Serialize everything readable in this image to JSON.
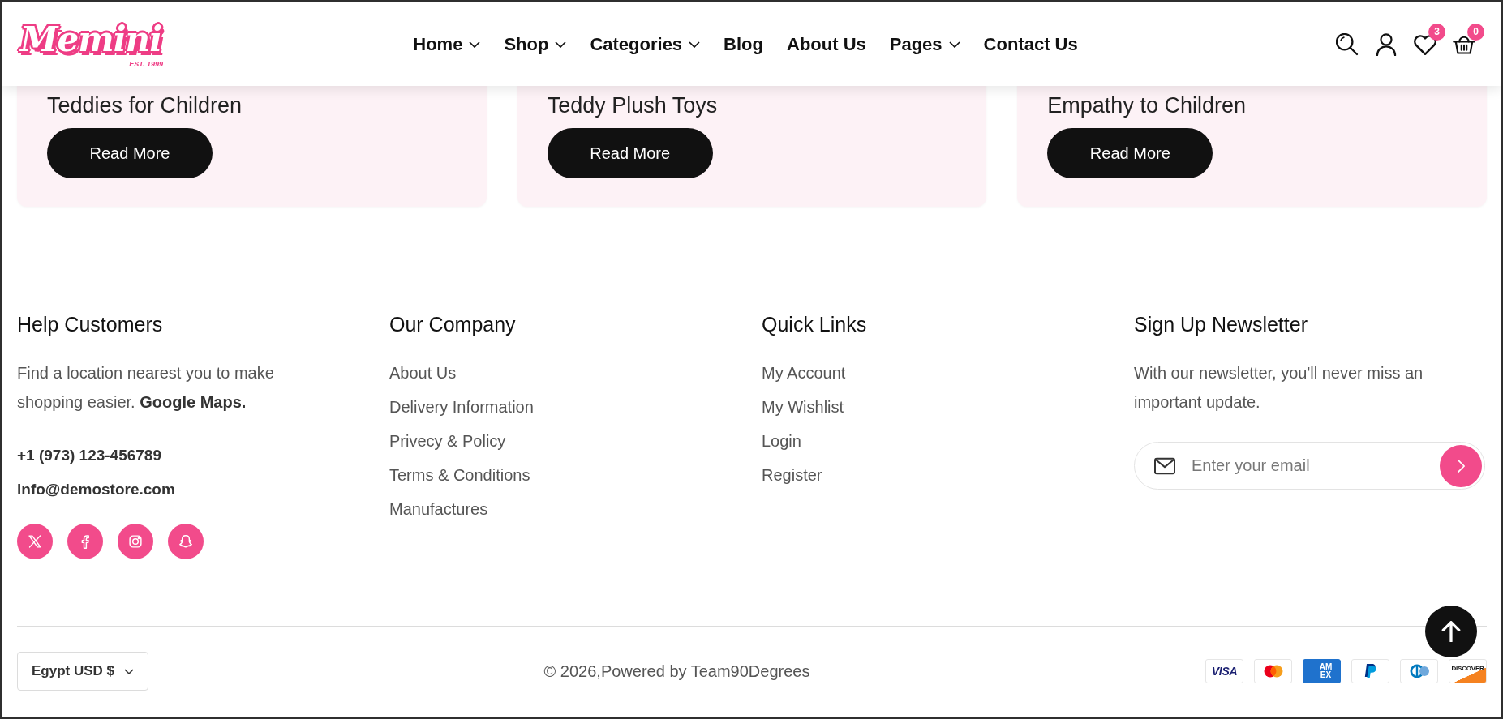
{
  "header": {
    "logo": {
      "wordmark": "Memini",
      "tagline": "EST. 1999"
    },
    "nav": [
      {
        "label": "Home",
        "dropdown": true
      },
      {
        "label": "Shop",
        "dropdown": true
      },
      {
        "label": "Categories",
        "dropdown": true
      },
      {
        "label": "Blog",
        "dropdown": false
      },
      {
        "label": "About Us",
        "dropdown": false
      },
      {
        "label": "Pages",
        "dropdown": true
      },
      {
        "label": "Contact Us",
        "dropdown": false
      }
    ],
    "wishlist_badge": "3",
    "cart_badge": "0"
  },
  "cards": [
    {
      "title": "Teddies for Children",
      "button": "Read More"
    },
    {
      "title": "Teddy Plush Toys",
      "button": "Read More"
    },
    {
      "title": "Empathy to Children",
      "button": "Read More"
    }
  ],
  "footer": {
    "columns": [
      {
        "kind": "contact",
        "heading": "Help Customers",
        "text": "Find a location nearest you to make shopping easier.",
        "link": "Google Maps.",
        "phone": "+1 (973) 123-456789",
        "email": "info@demostore.com"
      },
      {
        "kind": "links",
        "heading": "Our Company",
        "links": [
          "About Us",
          "Delivery Information",
          "Privecy & Policy",
          "Terms & Conditions",
          "Manufactures"
        ]
      },
      {
        "kind": "links",
        "heading": "Quick Links",
        "links": [
          "My Account",
          "My Wishlist",
          "Login",
          "Register"
        ]
      },
      {
        "kind": "newsletter",
        "heading": "Sign Up Newsletter",
        "text": "With our newsletter, you'll never miss an important update.",
        "placeholder": "Enter your email"
      }
    ]
  },
  "bottom_bar": {
    "currency": "Egypt USD $",
    "copyright": "© 2026,Powered by Team90Degrees",
    "payments": [
      {
        "kind": "visa",
        "label": "VISA"
      },
      {
        "kind": "mastercard"
      },
      {
        "kind": "amex",
        "label": "AM EX"
      },
      {
        "kind": "paypal"
      },
      {
        "kind": "diners"
      },
      {
        "kind": "discover",
        "label": "DISCOVER"
      }
    ]
  }
}
